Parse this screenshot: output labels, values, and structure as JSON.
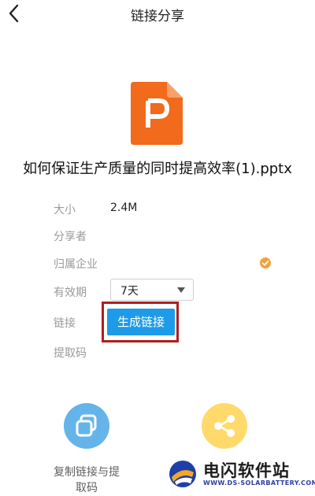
{
  "header": {
    "title": "链接分享"
  },
  "file": {
    "name": "如何保证生产质量的同时提高效率(1).pptx"
  },
  "details": {
    "size_label": "大小",
    "size_value": "2.4M",
    "sharer_label": "分享者",
    "company_label": "归属企业",
    "validity_label": "有效期",
    "validity_value": "7天",
    "link_label": "链接",
    "generate_button": "生成链接",
    "code_label": "提取码"
  },
  "actions": {
    "copy_label_line1": "复制链接与提",
    "copy_label_line2": "取码"
  },
  "watermark": {
    "text": "电闪软件站",
    "sub": "WWW.DS-SOLARBATTERY.COM"
  },
  "colors": {
    "accent_blue": "#1e9be8",
    "highlight_red": "#b21c1c",
    "ppt_orange": "#f26a1b",
    "action_blue": "#4aa8e6",
    "action_yellow": "#ffd452",
    "verify_orange": "#f2a23a"
  },
  "icons": {
    "back": "back-arrow-icon",
    "file": "ppt-file-icon",
    "verify": "verified-badge-icon",
    "caret": "caret-down-icon",
    "copy": "copy-icon",
    "share": "share-icon"
  }
}
